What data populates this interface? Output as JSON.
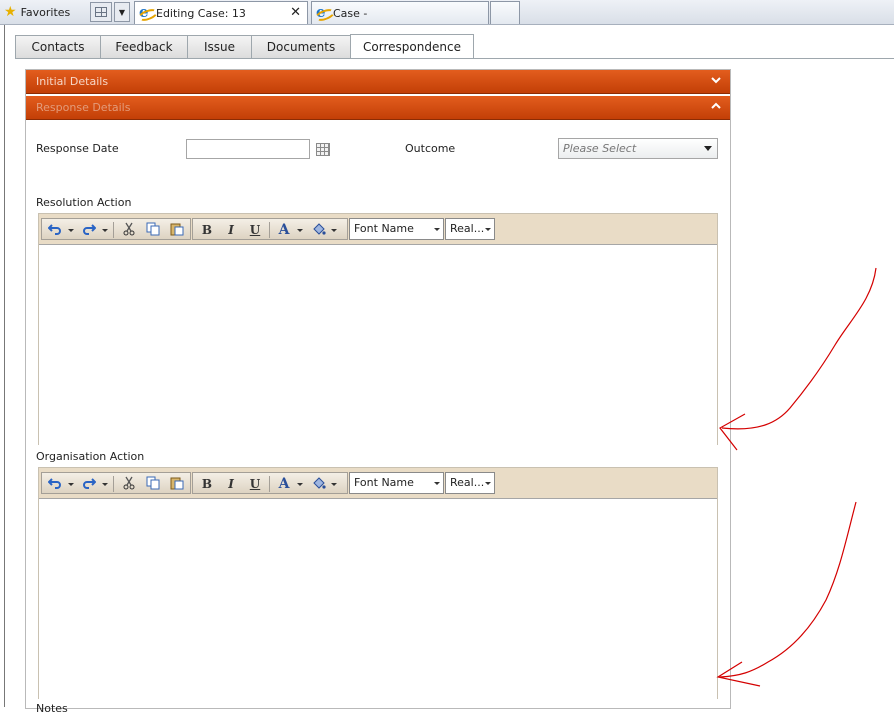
{
  "browser": {
    "favorites_label": "Favorites",
    "tabs": [
      {
        "label": "Editing Case: 13",
        "close": "✕"
      },
      {
        "label": "Case -"
      }
    ]
  },
  "page_tabs": [
    "Contacts",
    "Feedback",
    "Issue",
    "Documents",
    "Correspondence"
  ],
  "sections": {
    "initial": {
      "title": "Initial Details",
      "chevron": "⌄"
    },
    "response": {
      "title": "Response Details",
      "chevron": "⌃"
    }
  },
  "form": {
    "response_date_label": "Response Date",
    "response_date_value": "",
    "outcome_label": "Outcome",
    "outcome_value": "Please Select",
    "resolution_label": "Resolution Action",
    "organisation_label": "Organisation Action",
    "notes_label": "Notes"
  },
  "editor_toolbar": {
    "bold": "B",
    "italic": "I",
    "underline": "U",
    "font_color": "A",
    "font_name": "Font Name",
    "font_size": "Real..."
  },
  "icons": {
    "undo": "undo-icon",
    "redo": "redo-icon",
    "cut": "cut-icon",
    "copy": "copy-icon",
    "paste": "paste-icon",
    "highlight": "paint-bucket-icon",
    "calendar": "calendar-icon"
  },
  "colors": {
    "section_bar": "#d24a0f",
    "toolbar_bg": "#e9dcc6",
    "annotation": "#d40000"
  }
}
